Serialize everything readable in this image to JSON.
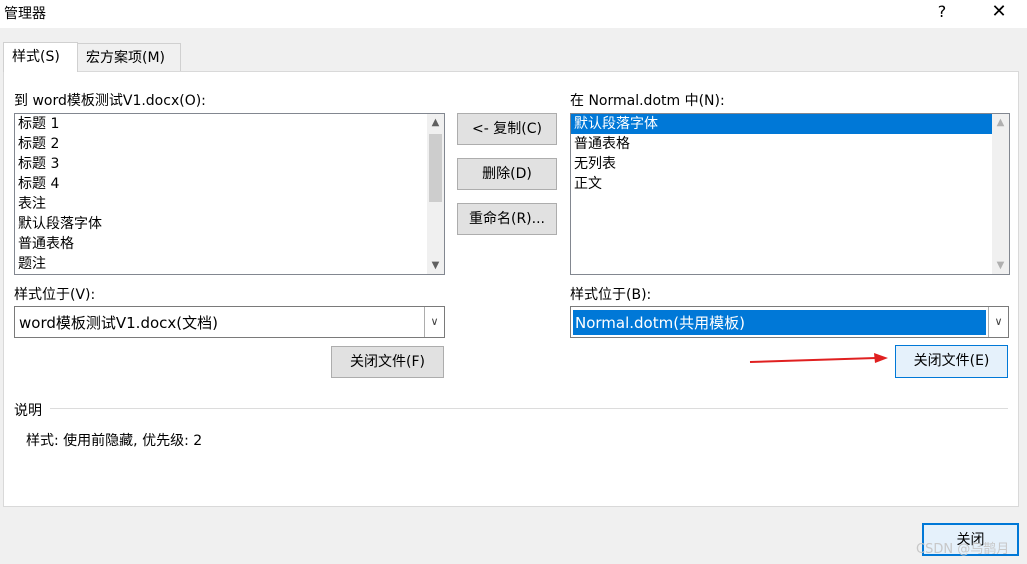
{
  "window": {
    "title": "管理器",
    "help": "?",
    "close": "✕"
  },
  "tabs": [
    {
      "label": "样式(S)"
    },
    {
      "label": "宏方案项(M)"
    }
  ],
  "left": {
    "label": "到 word模板测试V1.docx(O):",
    "items": [
      "标题 1",
      "标题 2",
      "标题 3",
      "标题 4",
      "表注",
      "默认段落字体",
      "普通表格",
      "题注"
    ],
    "location_label": "样式位于(V):",
    "location_value": "word模板测试V1.docx(文档)",
    "close_file": "关闭文件(F)"
  },
  "middle": {
    "copy": "<- 复制(C)",
    "delete": "删除(D)",
    "rename": "重命名(R)..."
  },
  "right": {
    "label": "在 Normal.dotm 中(N):",
    "items": [
      "默认段落字体",
      "普通表格",
      "无列表",
      "正文"
    ],
    "selected_index": 0,
    "location_label": "样式位于(B):",
    "location_value": "Normal.dotm(共用模板)",
    "close_file": "关闭文件(E)"
  },
  "description": {
    "heading": "说明",
    "text": "样式: 使用前隐藏, 优先级: 2"
  },
  "footer": {
    "close": "关闭",
    "watermark": "CSDN @乌鹊月"
  },
  "colors": {
    "selection": "#0078d7",
    "annotation_arrow": "#e02020"
  },
  "icons": {
    "scroll_up": "▲",
    "scroll_down": "▼",
    "dropdown": "∨"
  }
}
